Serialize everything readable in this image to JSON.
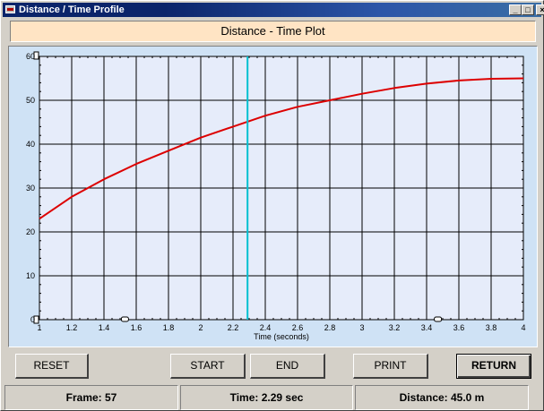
{
  "window": {
    "title": "Distance / Time Profile",
    "controls": {
      "minimize": "_",
      "maximize": "□",
      "close": "×"
    }
  },
  "plot_title": "Distance - Time Plot",
  "chart_data": {
    "type": "line",
    "title": "Distance - Time Plot",
    "xlabel": "Time (seconds)",
    "ylabel": "",
    "xlim": [
      1,
      4
    ],
    "ylim": [
      0,
      60
    ],
    "x_ticks": [
      "1",
      "1.2",
      "1.4",
      "1.6",
      "1.8",
      "2",
      "2.2",
      "2.4",
      "2.6",
      "2.8",
      "3",
      "3.2",
      "3.4",
      "3.6",
      "3.8",
      "4"
    ],
    "y_ticks": [
      "0",
      "10",
      "20",
      "30",
      "40",
      "50",
      "60"
    ],
    "grid": true,
    "series": [
      {
        "color": "#dd0000",
        "x": [
          1.0,
          1.2,
          1.4,
          1.6,
          1.8,
          2.0,
          2.2,
          2.4,
          2.6,
          2.8,
          3.0,
          3.2,
          3.4,
          3.6,
          3.8,
          4.0
        ],
        "y": [
          23.0,
          28.0,
          32.0,
          35.5,
          38.5,
          41.5,
          44.0,
          46.5,
          48.5,
          50.0,
          51.5,
          52.8,
          53.8,
          54.5,
          54.9,
          55.0
        ]
      }
    ],
    "cursor_x": 2.29,
    "cursor_color": "#00c0d0",
    "range_markers_x": [
      1.53,
      3.47
    ]
  },
  "buttons": {
    "reset": "RESET",
    "start": "START",
    "end": "END",
    "print": "PRINT",
    "return": "RETURN"
  },
  "status": {
    "frame": "Frame: 57",
    "time": "Time: 2.29 sec",
    "distance": "Distance: 45.0 m"
  }
}
